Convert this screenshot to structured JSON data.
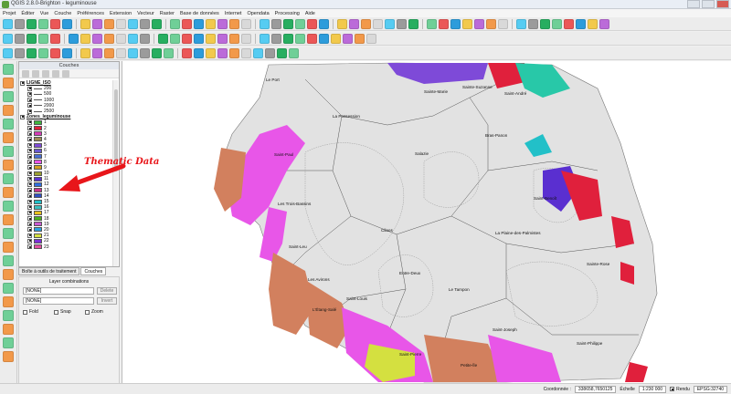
{
  "window": {
    "title": "QGIS 2.8.0-Brighton - leguminouse"
  },
  "menu": [
    "Projet",
    "Éditer",
    "Vue",
    "Couche",
    "Préférences",
    "Extension",
    "Vecteur",
    "Raster",
    "Base de données",
    "Internet",
    "Opendata",
    "Processing",
    "Aide"
  ],
  "layers_panel": {
    "title": "Couches",
    "groups": [
      {
        "name": "LIGNE_ISO",
        "items": [
          {
            "label": "200"
          },
          {
            "label": "500"
          },
          {
            "label": "1000"
          },
          {
            "label": "2000"
          },
          {
            "label": "2500"
          }
        ]
      },
      {
        "name": "Zones_leguminouse",
        "items": [
          {
            "label": "1",
            "color": "#3fb53f"
          },
          {
            "label": "2",
            "color": "#e0203c"
          },
          {
            "label": "3",
            "color": "#d63bb8"
          },
          {
            "label": "4",
            "color": "#9b8a55"
          },
          {
            "label": "5",
            "color": "#7e4ad8"
          },
          {
            "label": "6",
            "color": "#6a5ad0"
          },
          {
            "label": "7",
            "color": "#4a6fd6"
          },
          {
            "label": "8",
            "color": "#e856e8"
          },
          {
            "label": "9",
            "color": "#d4a020"
          },
          {
            "label": "10",
            "color": "#9aa030"
          },
          {
            "label": "11",
            "color": "#5a2fd0"
          },
          {
            "label": "12",
            "color": "#2f6fe0"
          },
          {
            "label": "13",
            "color": "#c8308a"
          },
          {
            "label": "14",
            "color": "#3050c0"
          },
          {
            "label": "15",
            "color": "#22c0c8"
          },
          {
            "label": "16",
            "color": "#3abfbf"
          },
          {
            "label": "17",
            "color": "#e8c020"
          },
          {
            "label": "18",
            "color": "#4ab020"
          },
          {
            "label": "19",
            "color": "#c85ad0"
          },
          {
            "label": "20",
            "color": "#28a0e0"
          },
          {
            "label": "21",
            "color": "#d6e040"
          },
          {
            "label": "22",
            "color": "#7c2fd8"
          },
          {
            "label": "23",
            "color": "#e050a0"
          }
        ]
      }
    ]
  },
  "panel_tabs": [
    "Boîte à outils de traitement",
    "Couches"
  ],
  "snapping": {
    "header": "Layer combinations",
    "field1": "[NONE]",
    "field2": "[NONE]",
    "delete_label": "Delete",
    "invert_label": "Invert",
    "fold_label": "Fold",
    "snap_label": "Snap",
    "zoom_label": "Zoom"
  },
  "annotation": {
    "text": "Thematic Data",
    "color": "#e8161a"
  },
  "map": {
    "labels": [
      "Le Port",
      "Sainte-Marie",
      "Sainte-Suzanne",
      "Saint-André",
      "La Possession",
      "Bras-Panon",
      "Saint-Paul",
      "Salazie",
      "Saint-Benoît",
      "Les Trois-Bassins",
      "Cilaos",
      "La Plaine-des-Palmistes",
      "Saint-Leu",
      "Entre-Deux",
      "Sainte-Rose",
      "Les Avirons",
      "Le Tampon",
      "Saint-Louis",
      "L'Étang-Salé",
      "Saint-Joseph",
      "Saint-Pierre",
      "Saint-Philippe",
      "Petite-Île"
    ]
  },
  "status": {
    "coord_label": "Coordonnée :",
    "coord_value": "338658,7650125",
    "scale_label": "Échelle",
    "scale_value": "1:230 000",
    "render_label": "Rendu",
    "crs": "EPSG:32740"
  }
}
